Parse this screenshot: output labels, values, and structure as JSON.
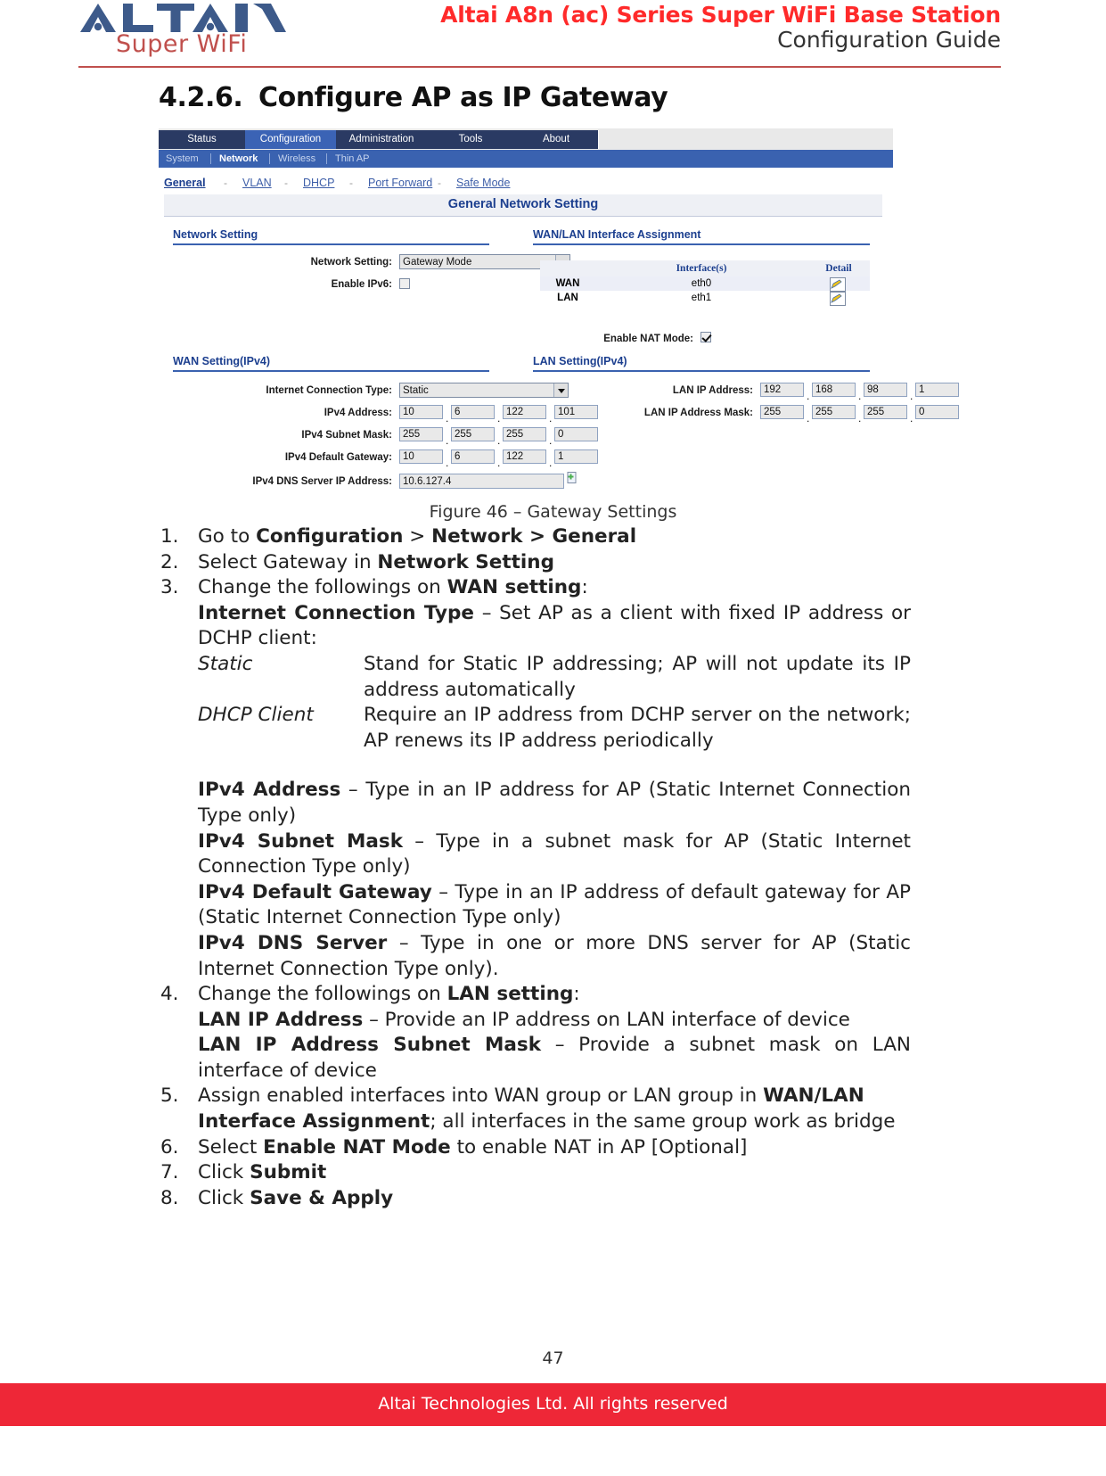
{
  "header": {
    "logo_text": "ALTAI",
    "logo_subtext": "Super WiFi",
    "title": "Altai A8n (ac) Series Super WiFi Base Station",
    "subtitle": "Configuration Guide",
    "accent_color": "#c0504d",
    "title_color": "#ff2a2a"
  },
  "section": {
    "number": "4.2.6.",
    "title": "Configure AP as IP Gateway"
  },
  "screenshot": {
    "tabs": [
      {
        "label": "Status",
        "active": false
      },
      {
        "label": "Configuration",
        "active": true
      },
      {
        "label": "Administration",
        "active": false
      },
      {
        "label": "Tools",
        "active": false
      },
      {
        "label": "About",
        "active": false
      }
    ],
    "subnav": [
      {
        "label": "System",
        "active": false
      },
      {
        "label": "Network",
        "active": true
      },
      {
        "label": "Wireless",
        "active": false
      },
      {
        "label": "Thin AP",
        "active": false
      }
    ],
    "breadcrumbs": [
      {
        "label": "General",
        "active": true
      },
      {
        "label": "VLAN",
        "active": false
      },
      {
        "label": "DHCP",
        "active": false
      },
      {
        "label": "Port Forward",
        "active": false
      },
      {
        "label": "Safe Mode",
        "active": false
      }
    ],
    "breadcrumb_separator": "-",
    "panel_title": "General Network Setting",
    "network_setting": {
      "group_title": "Network Setting",
      "mode_label": "Network Setting:",
      "mode_value": "Gateway Mode",
      "ipv6_label": "Enable IPv6:",
      "ipv6_checked": false
    },
    "interface_assignment": {
      "group_title": "WAN/LAN Interface Assignment",
      "columns": [
        "",
        "Interface(s)",
        "Detail"
      ],
      "rows": [
        {
          "group": "WAN",
          "interface": "eth0"
        },
        {
          "group": "LAN",
          "interface": "eth1"
        }
      ],
      "nat_label": "Enable NAT Mode:",
      "nat_checked": true
    },
    "wan_setting": {
      "group_title": "WAN Setting(IPv4)",
      "conn_type_label": "Internet Connection Type:",
      "conn_type_value": "Static",
      "ipv4_address_label": "IPv4 Address:",
      "ipv4_address": [
        "10",
        "6",
        "122",
        "101"
      ],
      "ipv4_mask_label": "IPv4 Subnet Mask:",
      "ipv4_mask": [
        "255",
        "255",
        "255",
        "0"
      ],
      "ipv4_gateway_label": "IPv4 Default Gateway:",
      "ipv4_gateway": [
        "10",
        "6",
        "122",
        "1"
      ],
      "dns_label": "IPv4 DNS Server IP Address:",
      "dns_value": "10.6.127.4"
    },
    "lan_setting": {
      "group_title": "LAN Setting(IPv4)",
      "lan_ip_label": "LAN IP Address:",
      "lan_ip": [
        "192",
        "168",
        "98",
        "1"
      ],
      "lan_mask_label": "LAN IP Address Mask:",
      "lan_mask": [
        "255",
        "255",
        "255",
        "0"
      ]
    }
  },
  "figure_caption": "Figure 46 – Gateway Settings",
  "steps": {
    "s1_num": "1.",
    "s1_a": "Go to ",
    "s1_b": "Configuration",
    "s1_c": " > ",
    "s1_d": "Network > General",
    "s2_num": "2.",
    "s2_a": "Select Gateway in  ",
    "s2_b": "Network Setting",
    "s3_num": "3.",
    "s3_a": "Change the followings on ",
    "s3_b": "WAN setting",
    "s3_c": ":",
    "ict_term": "Internet Connection Type",
    "ict_desc": " – Set AP as a client with fixed IP address or DCHP client:",
    "def_static_term": "Static",
    "def_static_desc": "Stand for Static IP addressing; AP will not update its IP address automatically",
    "def_dhcp_term": "DHCP Client",
    "def_dhcp_desc": "Require an IP address from DCHP server on the network; AP renews its IP address periodically",
    "ipv4addr_term": "IPv4  Address",
    "ipv4addr_desc": " – Type in an IP address for AP (Static Internet Connection Type only)",
    "ipv4mask_term": "IPv4 Subnet Mask",
    "ipv4mask_desc": " – Type in a subnet mask for AP (Static Internet Connection Type only)",
    "ipv4gw_term": "IPv4 Default Gateway",
    "ipv4gw_desc": " – Type in an IP address of default gateway for AP (Static Internet Connection Type only)",
    "ipv4dns_term": "IPv4  DNS  Server",
    "ipv4dns_desc": " – Type in one or more DNS server for AP (Static Internet Connection Type only).",
    "s4_num": "4.",
    "s4_a": "Change the followings on ",
    "s4_b": "LAN setting",
    "s4_c": ":",
    "lanip_term": "LAN IP Address",
    "lanip_desc": " – Provide an IP address on LAN interface of device",
    "lanmask_term": "LAN  IP  Address  Subnet  Mask",
    "lanmask_desc": " – Provide a subnet mask on LAN interface of device",
    "s5_num": "5.",
    "s5_a": "Assign enabled interfaces into WAN group or LAN group in ",
    "s5_b": "WAN/LAN Interface Assignment",
    "s5_c": "; all interfaces in the same group work as bridge",
    "s6_num": "6.",
    "s6_a": "Select ",
    "s6_b": "Enable NAT Mode",
    "s6_c": " to enable NAT in AP [Optional]",
    "s7_num": "7.",
    "s7_a": "Click ",
    "s7_b": "Submit",
    "s8_num": "8.",
    "s8_a": "Click ",
    "s8_b": "Save & Apply"
  },
  "footer": {
    "page_number": "47",
    "copyright": "Altai Technologies Ltd. All rights reserved",
    "bar_color": "#ee2737"
  }
}
